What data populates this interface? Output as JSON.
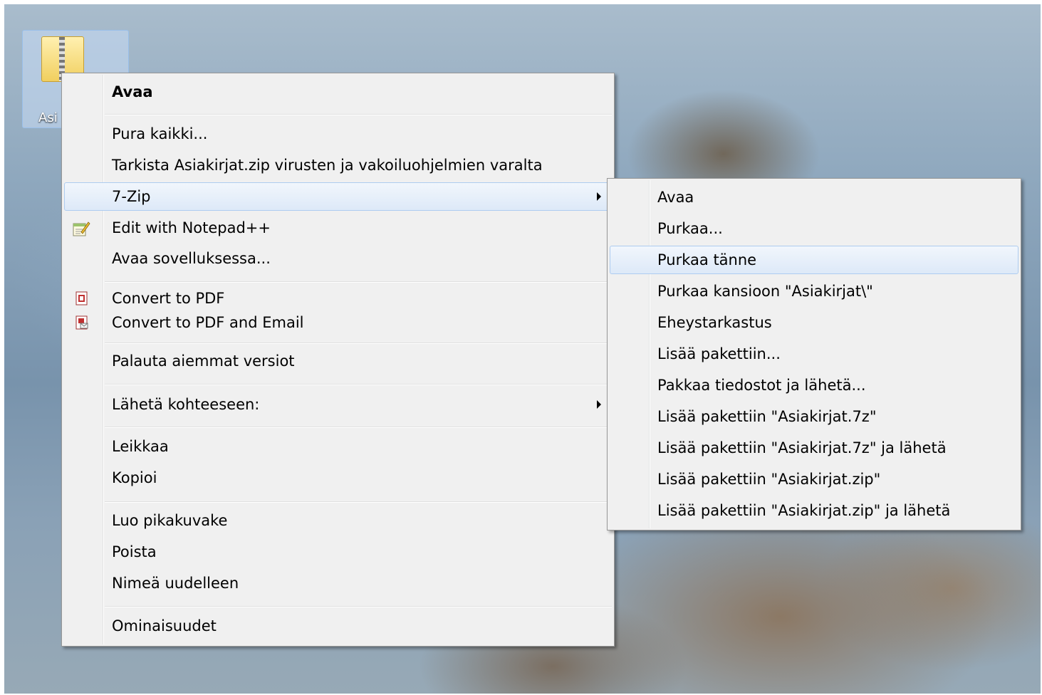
{
  "desktop": {
    "icon_label": "Asi"
  },
  "context_menu": {
    "items": [
      {
        "label": "Avaa"
      },
      {
        "label": "Pura kaikki..."
      },
      {
        "label": "Tarkista Asiakirjat.zip virusten ja vakoiluohjelmien varalta"
      },
      {
        "label": "7-Zip"
      },
      {
        "label": "Edit with Notepad++"
      },
      {
        "label": "Avaa sovelluksessa..."
      },
      {
        "label": "Convert to PDF"
      },
      {
        "label": "Convert to PDF and Email"
      },
      {
        "label": "Palauta aiemmat versiot"
      },
      {
        "label": "Lähetä kohteeseen:"
      },
      {
        "label": "Leikkaa"
      },
      {
        "label": "Kopioi"
      },
      {
        "label": "Luo pikakuvake"
      },
      {
        "label": "Poista"
      },
      {
        "label": "Nimeä uudelleen"
      },
      {
        "label": "Ominaisuudet"
      }
    ],
    "icons": {
      "notepad": "notepad-plus-plus-icon",
      "pdf": "pdf-icon",
      "pdf_email": "pdf-email-icon"
    }
  },
  "sevenzip_submenu": {
    "items": [
      {
        "label": "Avaa"
      },
      {
        "label": "Purkaa..."
      },
      {
        "label": "Purkaa tänne"
      },
      {
        "label": "Purkaa kansioon \"Asiakirjat\\\""
      },
      {
        "label": "Eheystarkastus"
      },
      {
        "label": "Lisää pakettiin..."
      },
      {
        "label": "Pakkaa tiedostot ja lähetä..."
      },
      {
        "label": "Lisää pakettiin \"Asiakirjat.7z\""
      },
      {
        "label": "Lisää pakettiin \"Asiakirjat.7z\" ja lähetä"
      },
      {
        "label": "Lisää pakettiin \"Asiakirjat.zip\""
      },
      {
        "label": "Lisää pakettiin \"Asiakirjat.zip\" ja lähetä"
      }
    ],
    "highlighted": "Purkaa tänne"
  },
  "colors": {
    "menu_bg": "#f0f0f0",
    "highlight_border": "#aeccf0",
    "highlight_bg": "#dde9f8"
  }
}
